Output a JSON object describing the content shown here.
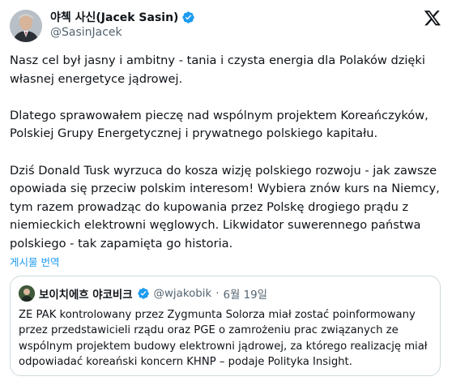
{
  "author": {
    "display_name": "야첵 사신(Jacek Sasin)",
    "handle": "@SasinJacek",
    "verified": true
  },
  "tweet": {
    "paragraphs": [
      "Nasz cel był jasny i ambitny - tania i czysta energia dla Polaków dzięki własnej energetyce jądrowej.",
      "Dlatego sprawowałem pieczę nad wspólnym projektem Koreańczyków, Polskiej Grupy Energetycznej i prywatnego polskiego kapitału.",
      "Dziś Donald Tusk wyrzuca do kosza wizję polskiego rozwoju - jak zawsze opowiada się przeciw polskim interesom! Wybiera znów kurs na Niemcy, tym razem prowadząc do kupowania przez Polskę drogiego prądu z niemieckich elektrowni węglowych. Likwidator suwerennego państwa polskiego - tak zapamięta go historia."
    ],
    "translate_label": "게시물 번역"
  },
  "quoted": {
    "display_name": "보이치에흐 야코비크",
    "handle": "@wjakobik",
    "separator": "·",
    "date": "6월 19일",
    "verified": true,
    "text": "ZE PAK kontrolowany przez Zygmunta Solorza miał zostać poinformowany przez przedstawicieli rządu oraz PGE o zamrożeniu prac związanych ze wspólnym projektem budowy elektrowni jądrowej, za którego realizację miał odpowiadać koreański koncern KHNP – podaje Polityka Insight."
  },
  "icons": {
    "verified": "verified-badge-icon",
    "platform": "x-logo-icon"
  },
  "colors": {
    "accent": "#1d9bf0",
    "text": "#0f1419",
    "muted": "#536471",
    "border": "#cfd9de"
  }
}
